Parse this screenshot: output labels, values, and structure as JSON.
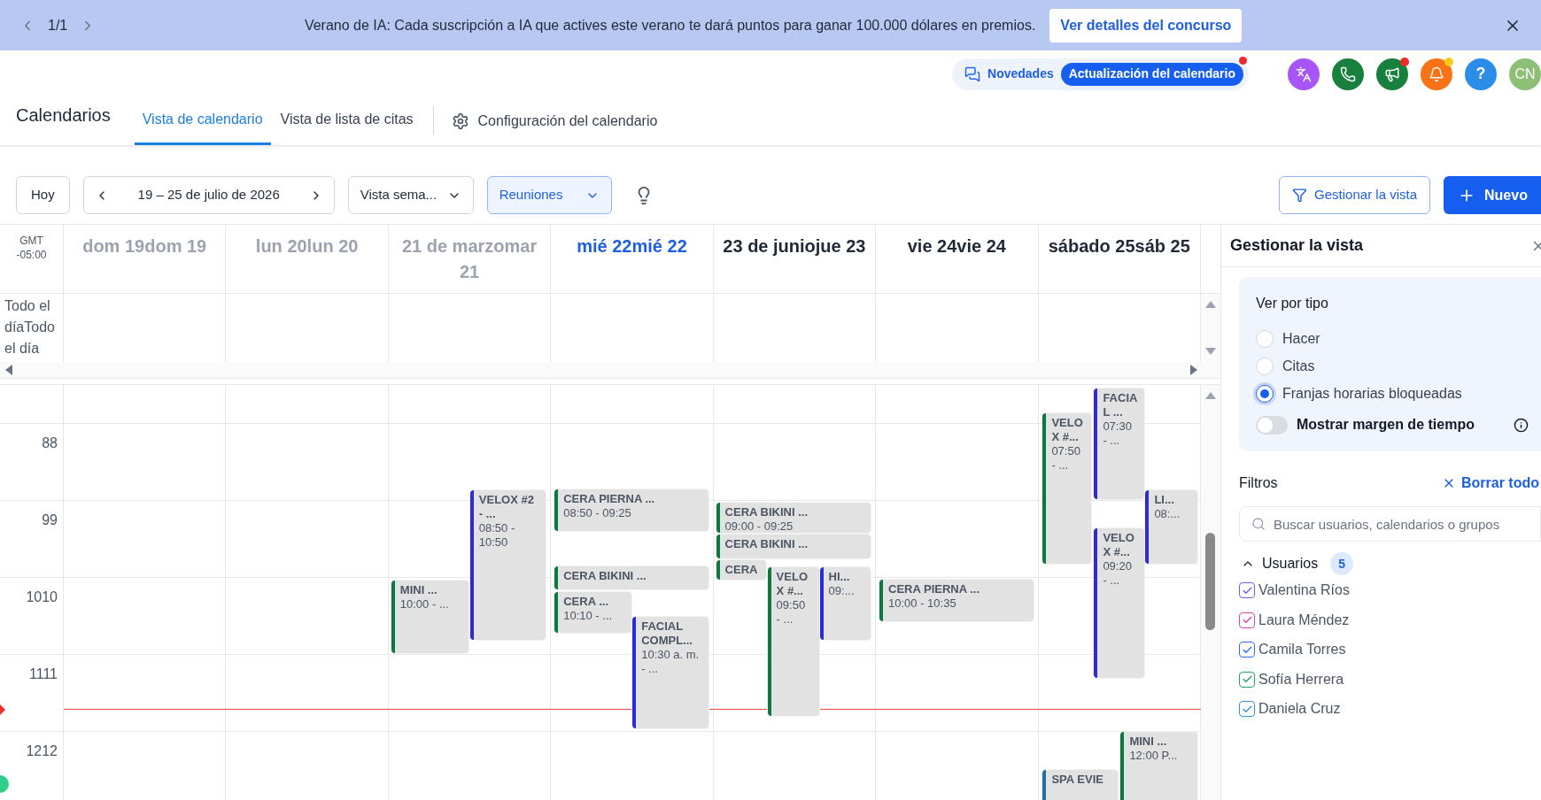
{
  "banner": {
    "pager": "1/1",
    "message": "Verano de IA: Cada suscripción a IA que actives este verano te dará puntos para ganar 100.000 dólares en premios.",
    "cta": "Ver detalles del concurso"
  },
  "header": {
    "news": {
      "label": "Novedades",
      "badge": "Actualización del calendario",
      "dot": true
    },
    "actions": [
      {
        "kind": "translate",
        "dot": false
      },
      {
        "kind": "phone",
        "dot": false
      },
      {
        "kind": "megaphone",
        "dot": true
      },
      {
        "kind": "bell",
        "dot": true
      },
      {
        "kind": "help",
        "label": "?",
        "dot": false
      },
      {
        "kind": "avatar",
        "label": "CN",
        "dot": false
      }
    ]
  },
  "nav": {
    "title": "Calendarios",
    "tabs": [
      {
        "label": "Vista de calendario",
        "selected": true
      },
      {
        "label": "Vista de lista de citas",
        "selected": false
      }
    ],
    "settings": "Configuración del calendario"
  },
  "toolbar": {
    "today": "Hoy",
    "range": "19 – 25 de julio de 2026",
    "view": "Vista sema...",
    "calendar_filter": {
      "label": "Reuniones",
      "active": true
    },
    "manage": "Gestionar la vista",
    "new": "Nuevo"
  },
  "calendar": {
    "timezone": [
      "GMT",
      "-05:00"
    ],
    "days": [
      {
        "label": "dom 19dom 19",
        "kind": "past"
      },
      {
        "label": "lun 20lun 20",
        "kind": "past"
      },
      {
        "label": "21 de marzomar 21",
        "kind": "past"
      },
      {
        "label": "mié 22mié 22",
        "kind": "today"
      },
      {
        "label": "23 de juniojue 23",
        "kind": "future"
      },
      {
        "label": "vie 24vie 24",
        "kind": "future"
      },
      {
        "label": "sábado 25sáb 25",
        "kind": "future"
      }
    ],
    "all_day": "Todo el díaTodo el día",
    "hours": [
      "88",
      "99",
      "1010",
      "1111",
      "1212"
    ],
    "events": [
      {
        "title": "MINI ...",
        "time": "10:00 - ...",
        "color": "#0b7a3f"
      },
      {
        "title": "VELOX #2 - ...",
        "time": "08:50 - 10:50",
        "color": "#2c2cd4"
      },
      {
        "title": "CERA PIERNA ...",
        "time": "08:50 - 09:25",
        "color": "#0b7a3f"
      },
      {
        "title": "CERA BIKINI ...",
        "color": "#0b7a3f"
      },
      {
        "title": "CERA ...",
        "time": "10:10 - ...",
        "color": "#0b7a3f"
      },
      {
        "title": "FACIAL COMPL...",
        "time": "10:30 a. m. - ...",
        "color": "#2c2cd4"
      },
      {
        "title": "CERA BIKINI ...",
        "time": "09:00 - 09:25",
        "color": "#0b7a3f"
      },
      {
        "title": "CERA BIKINI ...",
        "color": "#0b7a3f"
      },
      {
        "title": "CERA",
        "color": "#0b7a3f"
      },
      {
        "title": "VELOX #...",
        "time": "09:50 - ...",
        "color": "#0b7a3f"
      },
      {
        "title": "HI...",
        "time": "09:...",
        "color": "#2c2cd4"
      },
      {
        "title": "CERA PIERNA ...",
        "time": "10:00 - 10:35",
        "color": "#0b7a3f"
      },
      {
        "title": "VELOX #...",
        "time": "07:50 - ...",
        "color": "#0b7a3f"
      },
      {
        "title": "FACIAL ...",
        "time": "07:30 - ...",
        "color": "#2c2cd4"
      },
      {
        "title": "LI...",
        "time": "08:...",
        "color": "#2c2cd4"
      },
      {
        "title": "VELOX #...",
        "time": "09:20 - ...",
        "color": "#2c2cd4"
      },
      {
        "title": "MINI ...",
        "time": "12:00 P...",
        "color": "#0b7a3f"
      },
      {
        "title": "SPA EVIE",
        "color": "#1f6fa8"
      }
    ]
  },
  "panel": {
    "title": "Gestionar la vista",
    "view_by": {
      "heading": "Ver por tipo",
      "options": [
        {
          "label": "Hacer",
          "selected": false
        },
        {
          "label": "Citas",
          "selected": false
        },
        {
          "label": "Franjas horarias bloqueadas",
          "selected": true
        }
      ],
      "toggle": {
        "label": "Mostrar margen de tiempo",
        "on": false
      }
    },
    "filters": {
      "heading": "Filtros",
      "clear": "Borrar todo",
      "search_placeholder": "Buscar usuarios, calendarios o grupos",
      "group": {
        "label": "Usuarios",
        "count": "5",
        "expanded": true
      },
      "users": [
        {
          "name": "Valentina Ríos",
          "checked": true,
          "color": "#6b5cf0"
        },
        {
          "name": "Laura Méndez",
          "checked": true,
          "color": "#d946a8"
        },
        {
          "name": "Camila Torres",
          "checked": true,
          "color": "#2f6fe8"
        },
        {
          "name": "Sofía Herrera",
          "checked": true,
          "color": "#22a06b"
        },
        {
          "name": "Daniela Cruz",
          "checked": true,
          "color": "#3b8fd6"
        }
      ]
    }
  }
}
